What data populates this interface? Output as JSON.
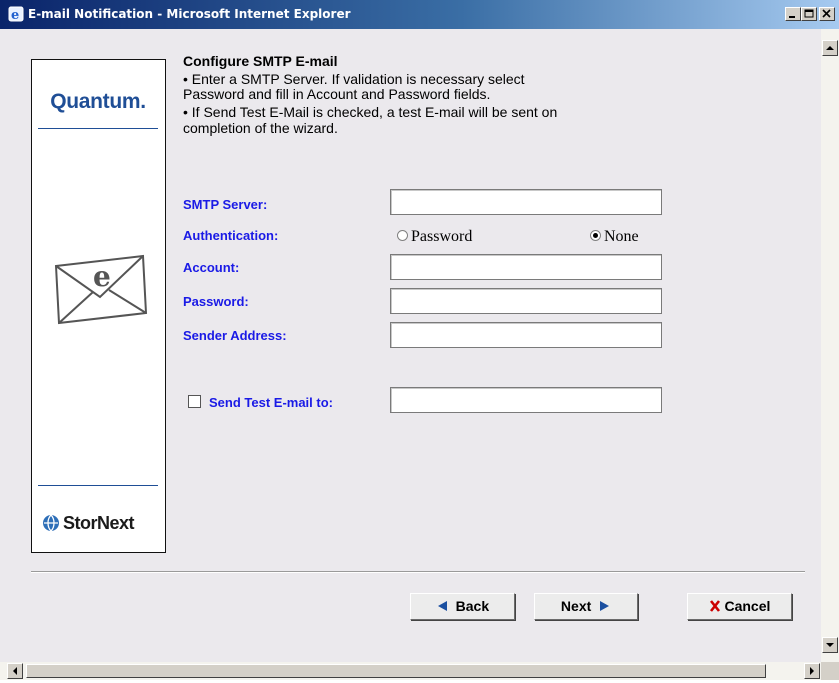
{
  "window": {
    "title": "E-mail Notification - Microsoft Internet Explorer"
  },
  "branding": {
    "top_logo": "Quantum.",
    "bottom_logo": "StorNext"
  },
  "content": {
    "heading": "Configure SMTP E-mail",
    "bullet1_line1": "•  Enter a SMTP Server. If validation is necessary select",
    "bullet1_line2": "Password and fill in Account and Password fields.",
    "bullet2_line1": "•  If Send Test E-Mail is checked, a test E-mail will be sent on",
    "bullet2_line2": "completion of the wizard."
  },
  "form": {
    "smtp_server_label": "SMTP Server:",
    "smtp_server_value": "",
    "authentication_label": "Authentication:",
    "auth_option_password": "Password",
    "auth_option_none": "None",
    "auth_selected": "None",
    "account_label": "Account:",
    "account_value": "",
    "password_label": "Password:",
    "password_value": "",
    "sender_label": "Sender Address:",
    "sender_value": "",
    "send_test_label": "Send Test E-mail to:",
    "send_test_checked": false,
    "send_test_value": ""
  },
  "buttons": {
    "back": "Back",
    "next": "Next",
    "cancel": "Cancel"
  },
  "colors": {
    "label_blue": "#1a1ae6",
    "quantum_blue": "#1f4e96",
    "cancel_x_red": "#cc0000",
    "nav_arrow_blue": "#1a4fa0"
  },
  "icons": {
    "window": "ie-icon",
    "envelope": "email-envelope-icon",
    "back": "left-arrow-icon",
    "next": "right-arrow-icon",
    "cancel": "red-x-icon"
  }
}
